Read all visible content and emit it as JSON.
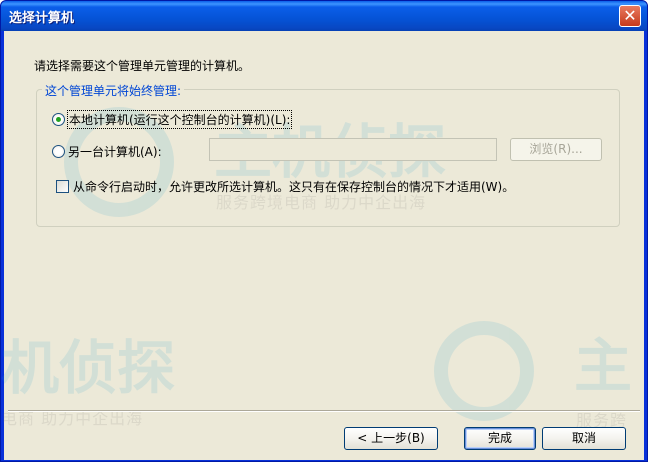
{
  "window": {
    "title": "选择计算机",
    "close_glyph": "✕"
  },
  "instruction": "请选择需要这个管理单元管理的计算机。",
  "group": {
    "legend": "这个管理单元将始终管理:",
    "local_label": "本地计算机(运行这个控制台的计算机)(L):",
    "local_checked": true,
    "other_label": "另一台计算机(A):",
    "other_checked": false,
    "computer_value": "",
    "browse_label": "浏览(R)..."
  },
  "option": {
    "allow_change_label": "从命令行启动时，允许更改所选计算机。这只有在保存控制台的情况下才适用(W)。",
    "allow_change_checked": false
  },
  "buttons": {
    "back": "< 上一步(B)",
    "finish": "完成",
    "cancel": "取消"
  },
  "watermark": {
    "brand_top": "主机侦探",
    "slogan_top": "服务跨境电商 助力中企出海",
    "brand_left": "机侦探",
    "slogan_left": "电商 助力中企出海",
    "brand_right": "主",
    "slogan_right": "服务跨"
  },
  "colors": {
    "titlebar": "#0553d6",
    "dialog_bg": "#ece9d8",
    "legend_text": "#0046d5",
    "close_button": "#c53a1b"
  }
}
